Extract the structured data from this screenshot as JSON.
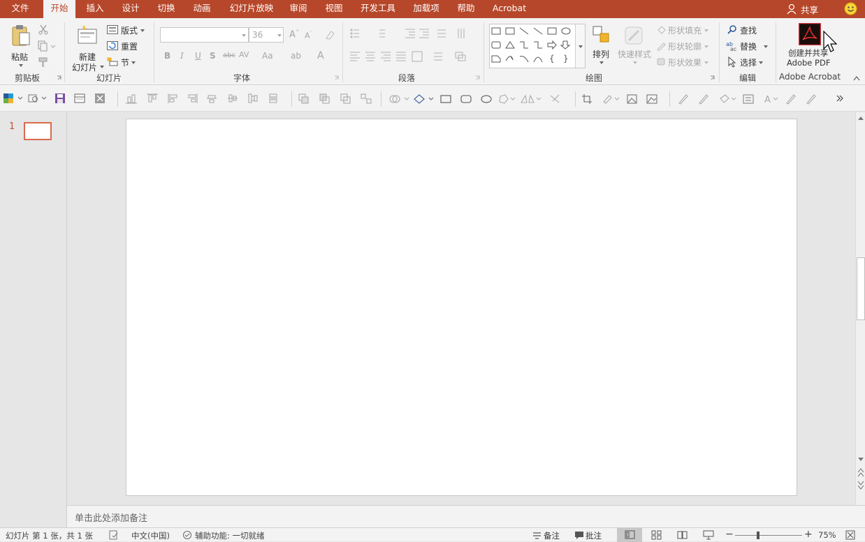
{
  "tabs": [
    {
      "label": "文件",
      "active": false
    },
    {
      "label": "开始",
      "active": true
    },
    {
      "label": "插入",
      "active": false
    },
    {
      "label": "设计",
      "active": false
    },
    {
      "label": "切换",
      "active": false
    },
    {
      "label": "动画",
      "active": false
    },
    {
      "label": "幻灯片放映",
      "active": false
    },
    {
      "label": "审阅",
      "active": false
    },
    {
      "label": "视图",
      "active": false
    },
    {
      "label": "开发工具",
      "active": false
    },
    {
      "label": "加载项",
      "active": false
    },
    {
      "label": "帮助",
      "active": false
    },
    {
      "label": "Acrobat",
      "active": false
    }
  ],
  "share": {
    "label": "共享"
  },
  "groups": {
    "clipboard": {
      "label": "剪贴板",
      "paste": "粘贴"
    },
    "slides": {
      "label": "幻灯片",
      "new_slide_1": "新建",
      "new_slide_2": "幻灯片",
      "layout": "版式",
      "reset": "重置",
      "section": "节"
    },
    "font": {
      "label": "字体",
      "font_name": "",
      "font_size": "36"
    },
    "paragraph": {
      "label": "段落"
    },
    "drawing": {
      "label": "绘图",
      "arrange": "排列",
      "quick_styles": "快速样式",
      "shape_fill": "形状填充",
      "shape_outline": "形状轮廓",
      "shape_effects": "形状效果"
    },
    "editing": {
      "label": "编辑",
      "find": "查找",
      "replace": "替换",
      "select": "选择"
    },
    "acrobat": {
      "label": "Adobe Acrobat",
      "create_1": "创建并共享",
      "create_2": "Adobe PDF"
    }
  },
  "thumbnail": {
    "number": "1"
  },
  "notes": {
    "placeholder": "单击此处添加备注"
  },
  "status": {
    "slide_info": "幻灯片 第 1 张，共 1 张",
    "language": "中文(中国)",
    "accessibility": "辅助功能: 一切就绪",
    "notes_btn": "备注",
    "comments_btn": "批注",
    "zoom": "75%"
  },
  "colors": {
    "accent": "#b7472a",
    "ribbon_bg": "#f3f3f3",
    "thumb_border": "#d9694b"
  }
}
